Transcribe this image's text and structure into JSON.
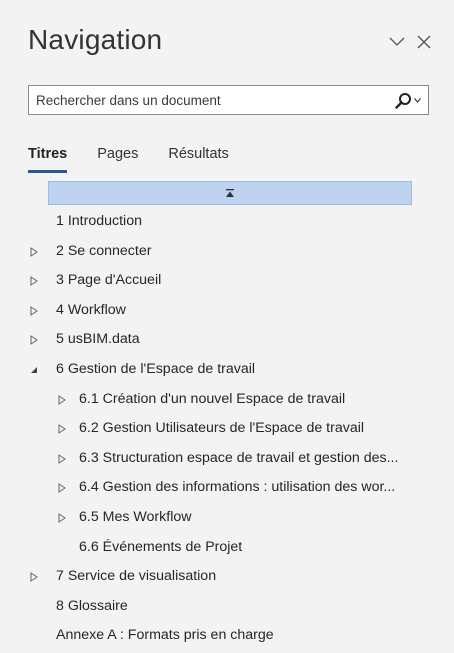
{
  "header": {
    "title": "Navigation",
    "chevron_icon": "chevron-down-icon",
    "close_icon": "close-icon"
  },
  "search": {
    "placeholder": "Rechercher dans un document",
    "icon": "search-icon"
  },
  "tabs": [
    {
      "label": "Titres",
      "active": true
    },
    {
      "label": "Pages",
      "active": false
    },
    {
      "label": "Résultats",
      "active": false
    }
  ],
  "collapse_bar": {
    "icon": "collapse-up-icon"
  },
  "tree": [
    {
      "label": "1 Introduction",
      "level": 0,
      "arrow": "none"
    },
    {
      "label": "2 Se connecter",
      "level": 0,
      "arrow": "collapsed"
    },
    {
      "label": "3 Page d'Accueil",
      "level": 0,
      "arrow": "collapsed"
    },
    {
      "label": "4 Workflow",
      "level": 0,
      "arrow": "collapsed"
    },
    {
      "label": "5 usBIM.data",
      "level": 0,
      "arrow": "collapsed"
    },
    {
      "label": "6 Gestion de l'Espace de travail",
      "level": 0,
      "arrow": "expanded"
    },
    {
      "label": "6.1 Création d'un nouvel Espace de travail",
      "level": 1,
      "arrow": "collapsed"
    },
    {
      "label": "6.2 Gestion Utilisateurs de l'Espace de travail",
      "level": 1,
      "arrow": "collapsed"
    },
    {
      "label": "6.3 Structuration espace de travail et gestion des...",
      "level": 1,
      "arrow": "collapsed"
    },
    {
      "label": "6.4 Gestion des informations : utilisation des wor...",
      "level": 1,
      "arrow": "collapsed"
    },
    {
      "label": "6.5  Mes Workflow",
      "level": 1,
      "arrow": "collapsed"
    },
    {
      "label": "6.6 Événements de Projet",
      "level": 1,
      "arrow": "none"
    },
    {
      "label": "7 Service de visualisation",
      "level": 0,
      "arrow": "collapsed"
    },
    {
      "label": "8 Glossaire",
      "level": 0,
      "arrow": "none"
    },
    {
      "label": "Annexe A : Formats pris en charge",
      "level": 0,
      "arrow": "none"
    }
  ]
}
